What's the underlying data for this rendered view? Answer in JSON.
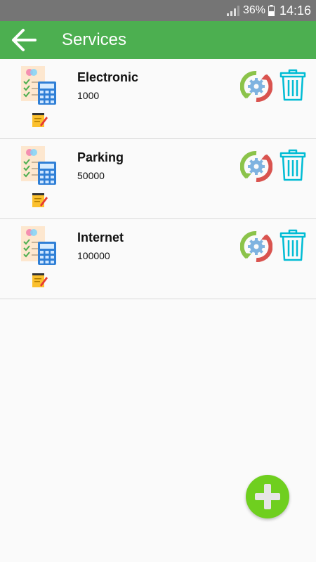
{
  "status_bar": {
    "battery_percent": "36%",
    "time": "14:16"
  },
  "app_bar": {
    "title": "Services",
    "back_icon": "arrow-left-icon"
  },
  "services": [
    {
      "name": "Electronic",
      "amount": "1000"
    },
    {
      "name": "Parking",
      "amount": "50000"
    },
    {
      "name": "Internet",
      "amount": "100000"
    }
  ],
  "row_icons": {
    "primary": "calculator-checklist-icon",
    "secondary": "notepad-pen-icon",
    "edit": "refresh-gear-icon",
    "delete": "trash-icon"
  },
  "fab": {
    "icon": "plus-icon"
  },
  "colors": {
    "app_bar": "#4caf50",
    "status_bar": "#757575",
    "fab": "#6fcf1f",
    "trash": "#00bcd4",
    "refresh_green": "#8bc34a",
    "refresh_red": "#d9534f"
  }
}
